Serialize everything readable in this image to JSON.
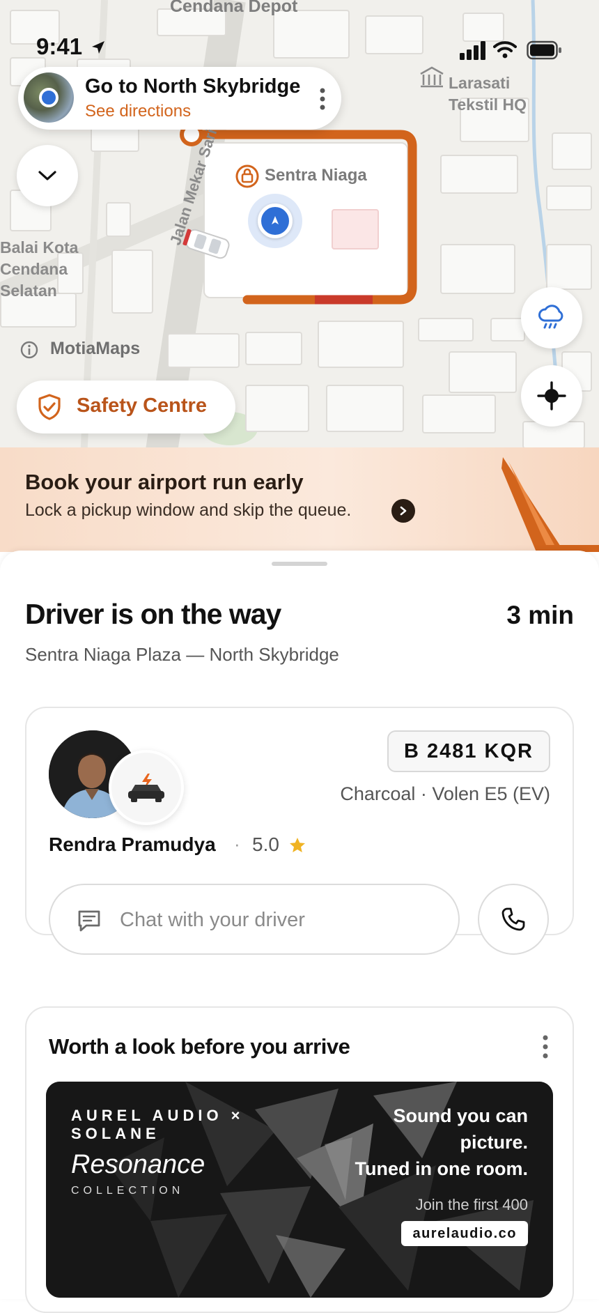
{
  "status_bar": {
    "time": "9:41"
  },
  "map": {
    "labels": {
      "depot": "Cendana Depot",
      "larasati": "Larasati\nTekstil HQ",
      "balai": "Balai Kota\nCendana\nSelatan",
      "sentra": "Sentra Niaga",
      "street": "Jalan Mekar Sari"
    },
    "attribution": "MotiaMaps",
    "safety_centre": "Safety Centre"
  },
  "directions": {
    "title": "Go to North Skybridge",
    "subtitle": "See directions"
  },
  "promo": {
    "title": "Book your airport run early",
    "subtitle": "Lock a pickup window and skip the queue."
  },
  "trip": {
    "status": "Driver is on the way",
    "eta": "3 min",
    "route": "Sentra Niaga Plaza — North Skybridge"
  },
  "driver": {
    "plate": "B 2481 KQR",
    "vehicle": "Charcoal · Volen E5 (EV)",
    "name": "Rendra Pramudya",
    "separator": "·",
    "rating": "5.0",
    "chat_placeholder": "Chat with your driver"
  },
  "ad_section": {
    "title": "Worth a look before you arrive",
    "brand": "AUREL AUDIO ×\nSOLANE",
    "collection_name": "Resonance",
    "collection_label": "COLLECTION",
    "headline": "Sound you can\npicture.\nTuned in one room.",
    "subline": "Join the first 400",
    "url": "aurelaudio.co"
  },
  "colors": {
    "accent": "#d2641c",
    "route": "#d2641c",
    "route_congested": "#c93a2a",
    "location_blue": "#2f6fd6",
    "star": "#f0b323"
  }
}
